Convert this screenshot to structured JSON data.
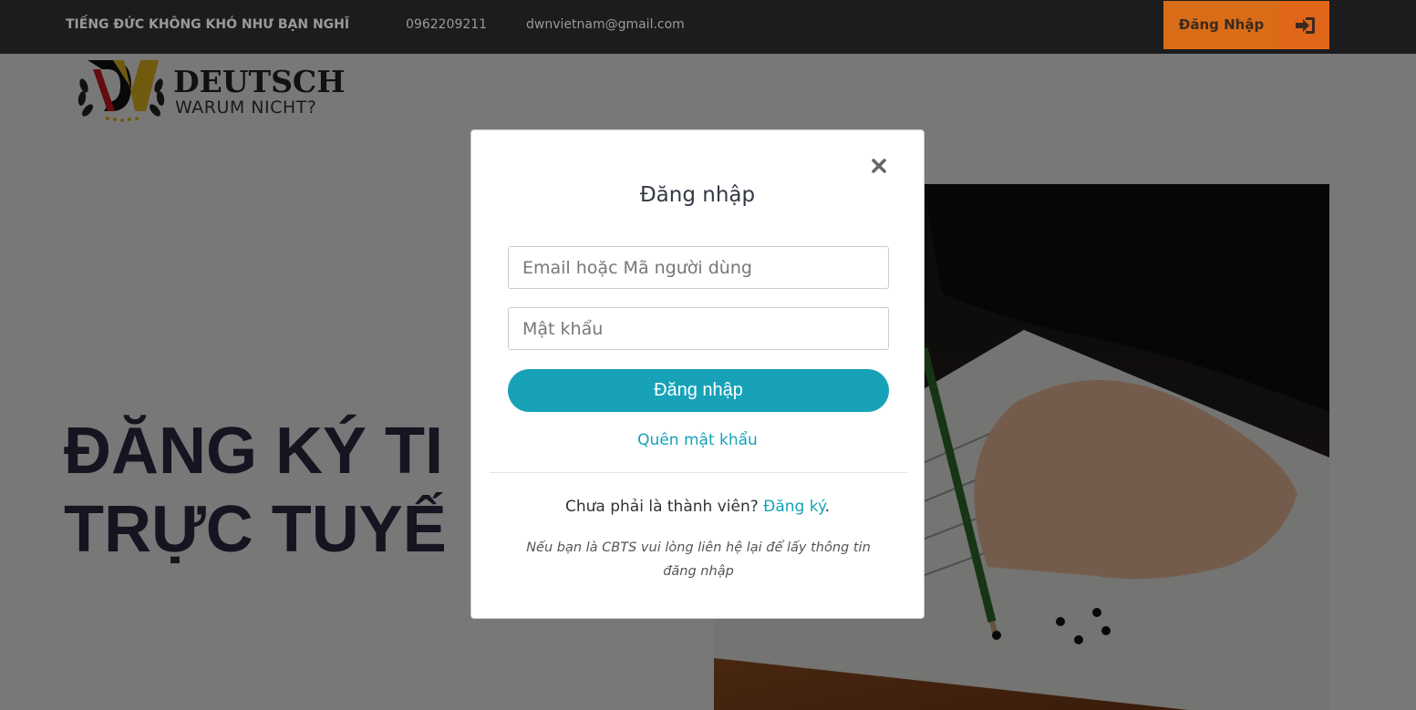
{
  "topbar": {
    "slogan": "TIẾNG ĐỨC KHÔNG KHÓ NHƯ BẠN NGHĨ",
    "phone": "0962209211",
    "email": "dwnvietnam@gmail.com",
    "login_label": "Đăng Nhập",
    "login_icon": "sign-in-icon"
  },
  "logo": {
    "monogram": "DW",
    "brand_line1": "DEUTSCH",
    "brand_line2": "WARUM NICHT?"
  },
  "hero": {
    "title_line1": "ĐĂNG KÝ TI",
    "title_line2": "TRỰC TUYẾ"
  },
  "modal": {
    "title": "Đăng nhập",
    "email_placeholder": "Email hoặc Mã người dùng",
    "password_placeholder": "Mật khẩu",
    "submit_label": "Đăng nhập",
    "forgot_label": "Quên mật khẩu",
    "signup_prefix": "Chưa phải là thành viên?",
    "signup_link": "Đăng ký",
    "signup_suffix": ".",
    "note": "Nếu bạn là CBTS vui lòng liên hệ lại để lấy thông tin đăng nhập"
  },
  "colors": {
    "accent": "#17a2b8",
    "topbar_bg": "#1c1c1e",
    "login_btn": "#d96c17",
    "hero_text": "#2a2840"
  }
}
